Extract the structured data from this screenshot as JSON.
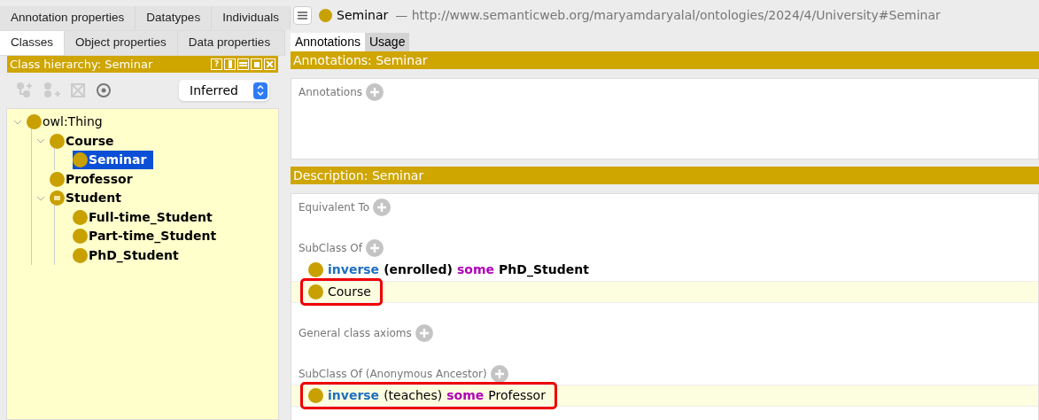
{
  "left_tabs": [
    [
      {
        "label": "Annotation properties",
        "selected": false
      },
      {
        "label": "Datatypes",
        "selected": false
      },
      {
        "label": "Individuals",
        "selected": false
      }
    ],
    [
      {
        "label": "Classes",
        "selected": true
      },
      {
        "label": "Object properties",
        "selected": false
      },
      {
        "label": "Data properties",
        "selected": false
      }
    ]
  ],
  "hierarchy": {
    "title": "Class hierarchy: Seminar",
    "view_buttons": [
      {
        "kind": "help",
        "label": "?"
      },
      {
        "kind": "split"
      },
      {
        "kind": "minimize"
      },
      {
        "kind": "maximize"
      },
      {
        "kind": "close"
      }
    ],
    "mode": "Inferred",
    "tree": [
      {
        "label": "owl:Thing",
        "kind": "primitive",
        "bold": false,
        "selected": false,
        "expanded": true,
        "children": [
          {
            "label": "Course",
            "kind": "primitive",
            "bold": true,
            "selected": false,
            "expanded": true,
            "children": [
              {
                "label": "Seminar",
                "kind": "primitive",
                "bold": true,
                "selected": true
              }
            ]
          },
          {
            "label": "Professor",
            "kind": "primitive",
            "bold": true,
            "selected": false
          },
          {
            "label": "Student",
            "kind": "defined",
            "bold": true,
            "selected": false,
            "expanded": true,
            "children": [
              {
                "label": "Full-time_Student",
                "kind": "primitive",
                "bold": true,
                "selected": false
              },
              {
                "label": "Part-time_Student",
                "kind": "primitive",
                "bold": true,
                "selected": false
              },
              {
                "label": "PhD_Student",
                "kind": "primitive",
                "bold": true,
                "selected": false
              }
            ]
          }
        ]
      }
    ]
  },
  "entity": {
    "name": "Seminar",
    "iri": "— http://www.semanticweb.org/maryamdaryalal/ontologies/2024/4/University#Seminar"
  },
  "right_tabs": [
    {
      "label": "Annotations",
      "selected": true
    },
    {
      "label": "Usage",
      "selected": false
    }
  ],
  "annotations_panel": {
    "title": "Annotations: Seminar",
    "sections": [
      {
        "label": "Annotations"
      }
    ]
  },
  "description_panel": {
    "title": "Description: Seminar",
    "sections": [
      {
        "label": "Equivalent To"
      },
      {
        "label": "SubClass Of",
        "items": [
          {
            "inferred": false,
            "outlined": false,
            "parts": [
              {
                "text": "inverse",
                "kind": "keyword"
              },
              {
                "text": "(enrolled)",
                "kind": "name"
              },
              {
                "text": "some",
                "kind": "quantifier"
              },
              {
                "text": "PhD_Student",
                "kind": "name"
              }
            ]
          },
          {
            "inferred": true,
            "outlined": true,
            "parts": [
              {
                "text": "Course",
                "kind": "name"
              }
            ]
          }
        ]
      },
      {
        "label": "General class axioms"
      },
      {
        "label": "SubClass Of (Anonymous Ancestor)",
        "items": [
          {
            "inferred": true,
            "outlined": true,
            "parts": [
              {
                "text": "inverse",
                "kind": "keyword"
              },
              {
                "text": "(teaches)",
                "kind": "name"
              },
              {
                "text": "some",
                "kind": "quantifier"
              },
              {
                "text": "Professor",
                "kind": "name"
              }
            ]
          }
        ]
      }
    ]
  }
}
